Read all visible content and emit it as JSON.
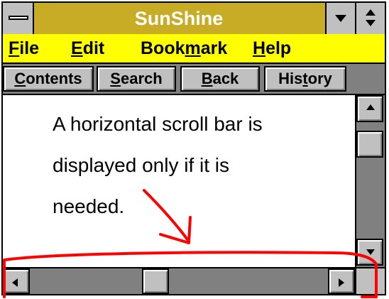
{
  "window": {
    "title": "SunShine"
  },
  "menu": {
    "items": [
      {
        "pre": "",
        "u": "F",
        "post": "ile"
      },
      {
        "pre": "",
        "u": "E",
        "post": "dit"
      },
      {
        "pre": "Book",
        "u": "m",
        "post": "ark"
      },
      {
        "pre": "",
        "u": "H",
        "post": "elp"
      }
    ]
  },
  "toolbar": {
    "buttons": [
      {
        "pre": "",
        "u": "C",
        "post": "ontents"
      },
      {
        "pre": "",
        "u": "S",
        "post": "earch"
      },
      {
        "pre": "",
        "u": "B",
        "post": "ack"
      },
      {
        "pre": "His",
        "u": "t",
        "post": "ory"
      }
    ]
  },
  "content": {
    "lines": [
      "A horizontal scroll bar is",
      "displayed only if it is",
      "needed."
    ]
  },
  "colors": {
    "title_bar": "#c8ac26",
    "menu_bar": "#ffff00",
    "annotation": "#ff0000"
  },
  "icons": {
    "system_menu": "system-menu-icon",
    "minimize": "minimize-arrow-icon",
    "maximize": "maximize-arrows-icon"
  }
}
